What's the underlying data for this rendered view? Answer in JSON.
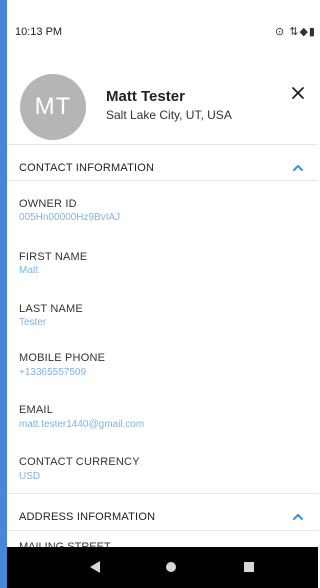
{
  "status": {
    "time": "10:13 PM",
    "icons": "⊙ ⇅◆▮"
  },
  "header": {
    "avatar_initials": "MT",
    "name": "Matt Tester",
    "location": "Salt Lake City, UT, USA"
  },
  "sections": {
    "contact": {
      "title": "CONTACT INFORMATION",
      "fields": [
        {
          "label": "OWNER ID",
          "value": "005Hn00000Hz9BvIAJ"
        },
        {
          "label": "FIRST NAME",
          "value": "Matt"
        },
        {
          "label": "LAST NAME",
          "value": "Tester"
        },
        {
          "label": "MOBILE PHONE",
          "value": "+13365557509"
        },
        {
          "label": "EMAIL",
          "value": "matt.tester1440@gmail.com"
        },
        {
          "label": "CONTACT CURRENCY",
          "value": "USD"
        }
      ]
    },
    "address": {
      "title": "ADDRESS INFORMATION",
      "next_label": "MAILING STREET"
    }
  },
  "colors": {
    "accent": "#4a86d8",
    "value_text": "#7fb2e3",
    "chevron": "#3b8fe0",
    "avatar_bg": "#b5b5b5"
  }
}
